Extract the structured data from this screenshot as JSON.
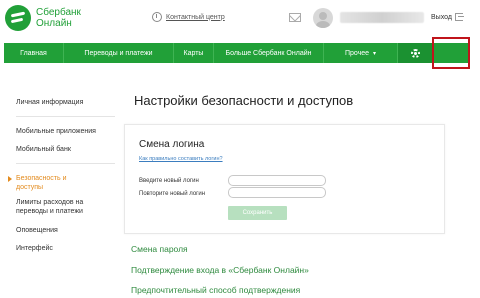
{
  "header": {
    "logo_line1": "Сбербанк",
    "logo_line2": "Онлайн",
    "contact_center": "Контактный центр",
    "logout": "Выход"
  },
  "nav": {
    "main": "Главная",
    "transfers": "Переводы и платежи",
    "cards": "Карты",
    "more_sberbank": "Больше Сбербанк Онлайн",
    "other": "Прочее",
    "other_caret": "▾"
  },
  "sidebar": {
    "items": [
      {
        "label": "Личная информация"
      },
      {
        "label": "Мобильные приложения"
      },
      {
        "label": "Мобильный банк"
      },
      {
        "label_line1": "Безопасность и",
        "label_line2": "доступы"
      },
      {
        "label_line1": "Лимиты расходов на",
        "label_line2": "переводы и платежи"
      },
      {
        "label": "Оповещения"
      },
      {
        "label": "Интерфейс"
      }
    ]
  },
  "main": {
    "title": "Настройки безопасности и доступов",
    "login_card": {
      "title": "Смена логина",
      "help_link": "Как правильно составить логин?",
      "new_login_label": "Введите новый логин",
      "repeat_login_label": "Повторите новый логин",
      "new_login_value": "",
      "repeat_login_value": "",
      "save_button": "Сохранить"
    },
    "links": {
      "change_password": "Смена пароля",
      "login_confirmation": "Подтверждение входа в «Сбербанк Онлайн»",
      "preferred_confirmation": "Предпочтительный способ подтверждения"
    }
  },
  "colors": {
    "brand_green": "#21a038",
    "active_orange": "#e38b1e",
    "highlight_red": "#c0141b"
  }
}
